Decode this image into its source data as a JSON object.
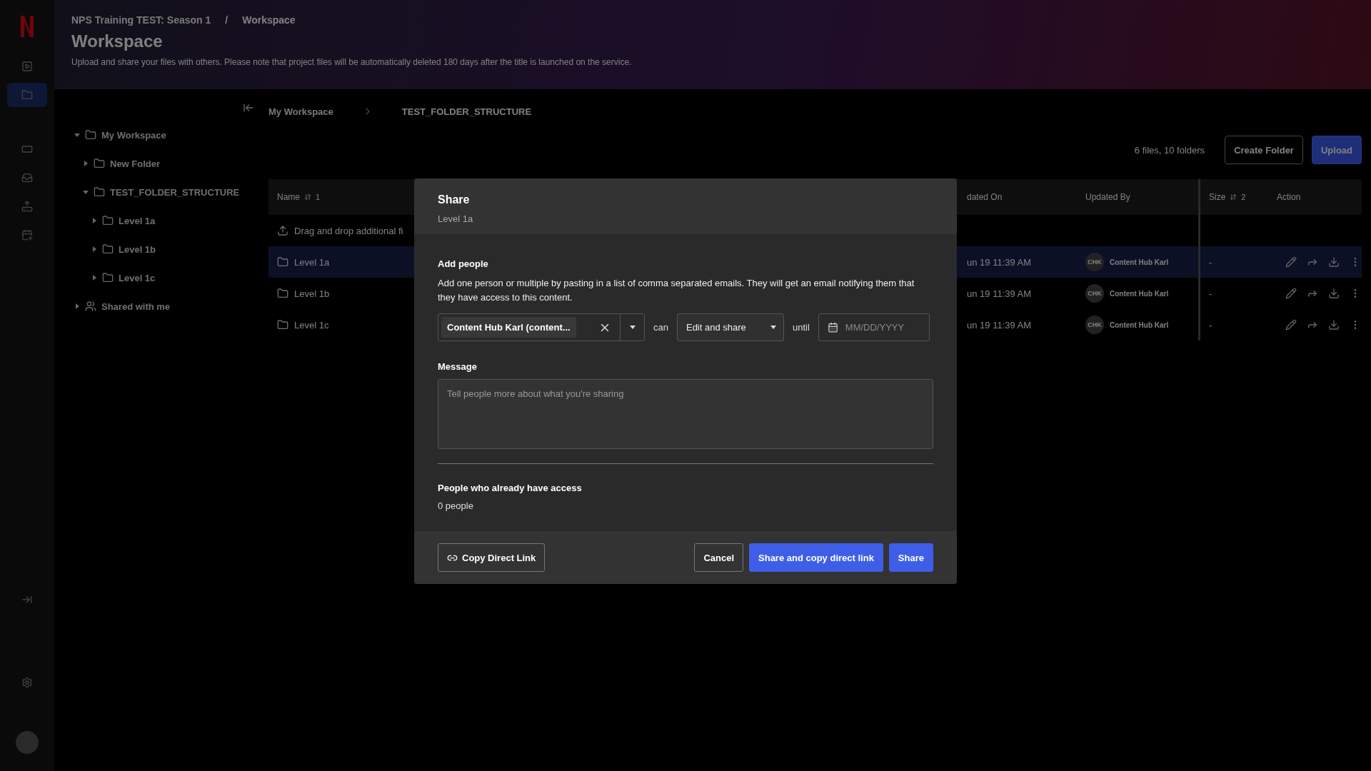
{
  "rail": {
    "items": [
      {
        "kind": "play",
        "selected": false
      },
      {
        "kind": "folder",
        "selected": true
      },
      {
        "kind": "monitor",
        "selected": false
      },
      {
        "kind": "inbox",
        "selected": false
      },
      {
        "kind": "outbox",
        "selected": false
      },
      {
        "kind": "calendar",
        "selected": false
      }
    ]
  },
  "header": {
    "breadcrumb": [
      "NPS Training TEST: Season 1",
      "/",
      "Workspace"
    ],
    "title": "Workspace",
    "subtitle": "Upload and share your files with others. Please note that project files will be automatically deleted 180 days after the title is launched on the service."
  },
  "tree": {
    "items": [
      {
        "label": "My Workspace",
        "kind": "folder",
        "expanded": true,
        "children": [
          {
            "label": "New Folder",
            "kind": "folder",
            "expanded": false
          },
          {
            "label": "TEST_FOLDER_STRUCTURE",
            "kind": "folder",
            "expanded": true,
            "children": [
              {
                "label": "Level 1a",
                "kind": "folder",
                "expanded": false
              },
              {
                "label": "Level 1b",
                "kind": "folder",
                "expanded": false
              },
              {
                "label": "Level 1c",
                "kind": "folder",
                "expanded": false
              }
            ]
          }
        ]
      },
      {
        "label": "Shared with me",
        "kind": "shared",
        "expanded": false
      }
    ]
  },
  "path": [
    "My Workspace",
    "TEST_FOLDER_STRUCTURE"
  ],
  "toolbar": {
    "count": "6 files, 10 folders",
    "buttons": [
      {
        "label": "Create Folder",
        "kind": "secondary"
      },
      {
        "label": "Upload",
        "kind": "primary"
      }
    ]
  },
  "table": {
    "columns": [
      {
        "label": "Name",
        "sort_rank": "1"
      },
      {
        "label": "dated On"
      },
      {
        "label": "Updated By"
      },
      {
        "label": "Size",
        "sort_rank": "2"
      },
      {
        "label": "Action"
      }
    ],
    "upload_row": "Drag and drop additional fi",
    "rows": [
      {
        "name": "Level 1a",
        "updated_on": "un 19 11:39 AM",
        "avatar": "CHK",
        "updated_by": "Content Hub Karl",
        "size": "-",
        "selected": true
      },
      {
        "name": "Level 1b",
        "updated_on": "un 19 11:39 AM",
        "avatar": "CHK",
        "updated_by": "Content Hub Karl",
        "size": "-",
        "selected": false
      },
      {
        "name": "Level 1c",
        "updated_on": "un 19 11:39 AM",
        "avatar": "CHK",
        "updated_by": "Content Hub Karl",
        "size": "-",
        "selected": false
      }
    ]
  },
  "dialog": {
    "title": "Share",
    "subtitle": "Level 1a",
    "add_people": {
      "heading": "Add people",
      "description": "Add one person or multiple by pasting in a list of comma separated emails. They will get an email notifying them that they have access to this content.",
      "person_chip": "Content Hub Karl (content...",
      "can": "can",
      "permission": "Edit and share",
      "until": "until",
      "date_placeholder": "MM/DD/YYYY"
    },
    "message": {
      "label": "Message",
      "placeholder": "Tell people more about what you're sharing"
    },
    "access": {
      "heading": "People who already have access",
      "count": "0 people"
    },
    "buttons": [
      {
        "label": "Copy Direct Link",
        "kind": "link"
      },
      {
        "label": "Cancel",
        "kind": "secondary"
      },
      {
        "label": "Share and copy direct link",
        "kind": "primary"
      },
      {
        "label": "Share",
        "kind": "primary"
      }
    ]
  }
}
